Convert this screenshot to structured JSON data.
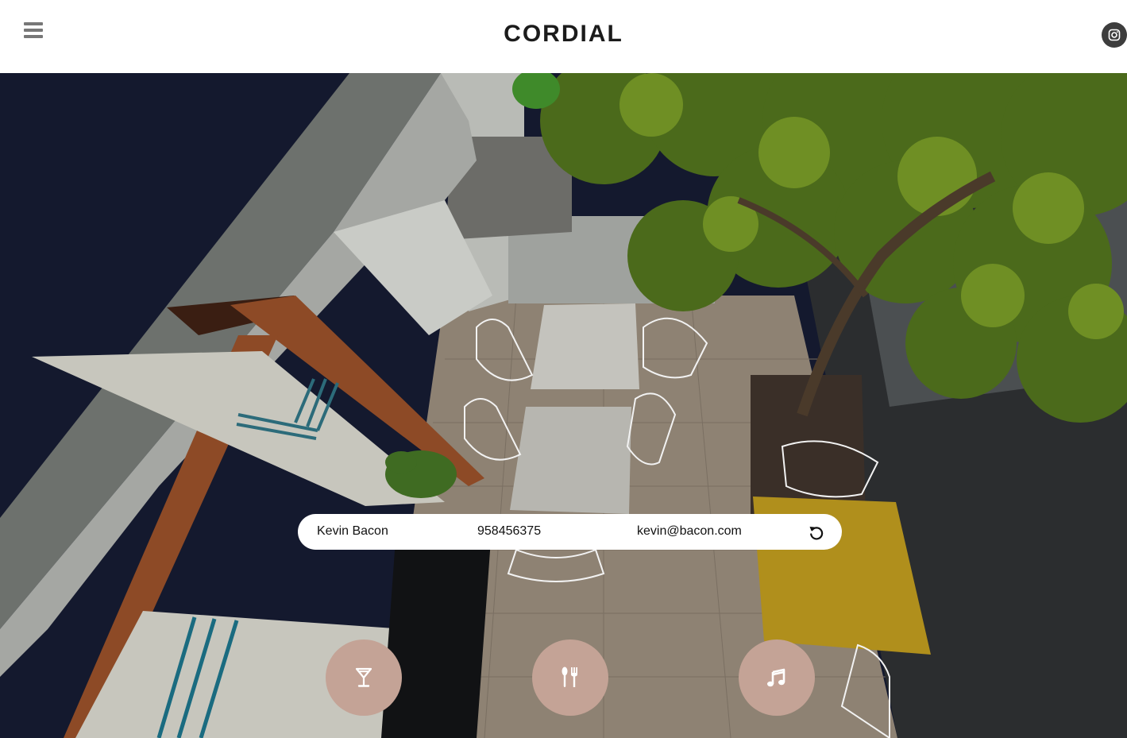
{
  "header": {
    "brand": "CORDIAL",
    "menu_icon": "hamburger-menu-icon",
    "social_icon": "instagram-icon"
  },
  "booking": {
    "name": "Kevin Bacon",
    "phone": "958456375",
    "email": "kevin@bacon.com",
    "reset_icon": "reset-icon"
  },
  "actions": [
    {
      "id": "drinks",
      "icon": "cocktail-icon"
    },
    {
      "id": "food",
      "icon": "cutlery-icon"
    },
    {
      "id": "music",
      "icon": "music-note-icon"
    }
  ],
  "colors": {
    "action_button": "#c4a396",
    "header_bg": "#ffffff",
    "social_button": "#3d3d3d",
    "night_sky": "#14192e",
    "table_yellow": "#b08f1c"
  }
}
